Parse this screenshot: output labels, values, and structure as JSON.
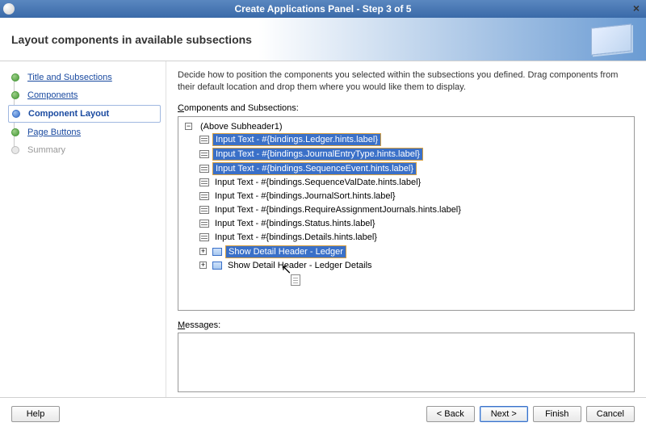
{
  "window": {
    "title": "Create Applications Panel - Step 3 of 5"
  },
  "banner": {
    "title": "Layout components in available subsections"
  },
  "sidebar": {
    "steps": [
      {
        "label": "Title and Subsections",
        "state": "done",
        "link": true
      },
      {
        "label": "Components",
        "state": "done",
        "link": true
      },
      {
        "label": "Component Layout",
        "state": "current",
        "link": false
      },
      {
        "label": "Page Buttons",
        "state": "done",
        "link": true
      },
      {
        "label": "Summary",
        "state": "future",
        "link": false
      }
    ]
  },
  "content": {
    "instruction": "Decide how to position the components you selected within the subsections you defined. Drag components from their default location and drop them where you would like them to display.",
    "tree_label": "Components and Subsections:",
    "tree": {
      "root": "(Above Subheader1)",
      "items": [
        {
          "label": "Input Text - #{bindings.Ledger.hints.label}",
          "kind": "input",
          "selected": true
        },
        {
          "label": "Input Text - #{bindings.JournalEntryType.hints.label}",
          "kind": "input",
          "selected": true
        },
        {
          "label": "Input Text - #{bindings.SequenceEvent.hints.label}",
          "kind": "input",
          "selected": true
        },
        {
          "label": "Input Text - #{bindings.SequenceValDate.hints.label}",
          "kind": "input",
          "selected": false
        },
        {
          "label": "Input Text - #{bindings.JournalSort.hints.label}",
          "kind": "input",
          "selected": false
        },
        {
          "label": "Input Text - #{bindings.RequireAssignmentJournals.hints.label}",
          "kind": "input",
          "selected": false
        },
        {
          "label": "Input Text - #{bindings.Status.hints.label}",
          "kind": "input",
          "selected": false
        },
        {
          "label": "Input Text - #{bindings.Details.hints.label}",
          "kind": "input",
          "selected": false
        },
        {
          "label": "Show Detail Header - Ledger",
          "kind": "header",
          "selected": true
        },
        {
          "label": "Show Detail Header - Ledger Details",
          "kind": "header",
          "selected": false
        }
      ]
    },
    "messages_label": "Messages:"
  },
  "footer": {
    "help": "Help",
    "back": "< Back",
    "next": "Next >",
    "finish": "Finish",
    "cancel": "Cancel"
  }
}
